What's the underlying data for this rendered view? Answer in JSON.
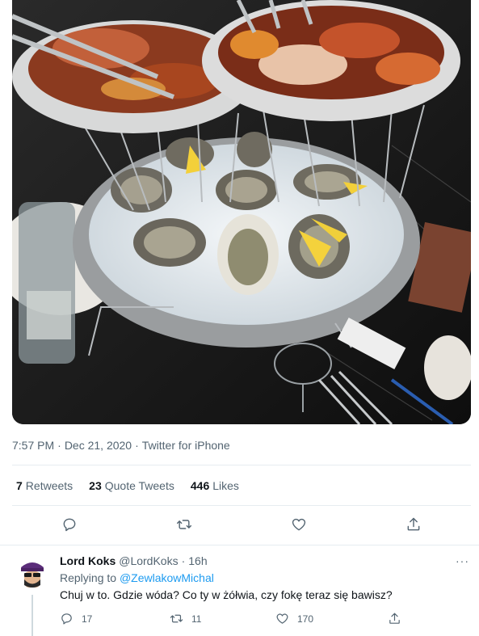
{
  "tweet": {
    "image_alt": "Seafood tower with oysters on ice, lobster and shrimp",
    "time": "7:57 PM",
    "separator": "·",
    "date": "Dec 21, 2020",
    "source": "Twitter for iPhone"
  },
  "stats": {
    "retweets_count": "7",
    "retweets_label": "Retweets",
    "quotes_count": "23",
    "quotes_label": "Quote Tweets",
    "likes_count": "446",
    "likes_label": "Likes"
  },
  "actions": {
    "icons": [
      "reply-icon",
      "retweet-icon",
      "like-icon",
      "share-icon"
    ]
  },
  "reply": {
    "name": "Lord Koks",
    "handle": "@LordKoks",
    "separator": "·",
    "time": "16h",
    "more": "···",
    "replying_prefix": "Replying to",
    "replying_to": "@ZewlakowMichal",
    "text": "Chuj w to. Gdzie wóda? Co ty w żółwia, czy fokę teraz się bawisz?",
    "reply_count": "17",
    "retweet_count": "11",
    "like_count": "170"
  },
  "colors": {
    "text_primary": "#0f1419",
    "text_secondary": "#536471",
    "link": "#1d9bf0",
    "divider": "#e6ecf0"
  }
}
